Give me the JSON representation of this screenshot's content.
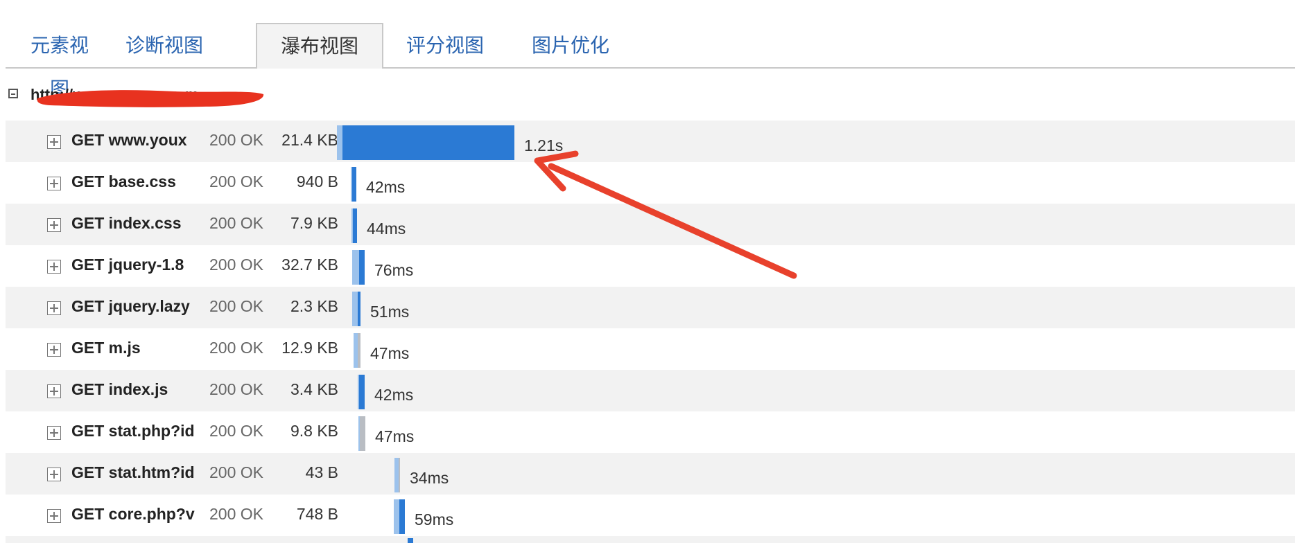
{
  "tabs": [
    {
      "label": "元素视图"
    },
    {
      "label": "诊断视图"
    },
    {
      "label": "瀑布视图"
    },
    {
      "label": "评分视图"
    },
    {
      "label": "图片优化"
    }
  ],
  "active_tab": "瀑布视图",
  "root": {
    "url": "http://www.yo.............m"
  },
  "requests": [
    {
      "name": "GET www.youx",
      "status": "200 OK",
      "size": "21.4 KB",
      "time": "1.21s"
    },
    {
      "name": "GET base.css",
      "status": "200 OK",
      "size": "940 B",
      "time": "42ms"
    },
    {
      "name": "GET index.css",
      "status": "200 OK",
      "size": "7.9 KB",
      "time": "44ms"
    },
    {
      "name": "GET jquery-1.8",
      "status": "200 OK",
      "size": "32.7 KB",
      "time": "76ms"
    },
    {
      "name": "GET jquery.lazy",
      "status": "200 OK",
      "size": "2.3 KB",
      "time": "51ms"
    },
    {
      "name": "GET m.js",
      "status": "200 OK",
      "size": "12.9 KB",
      "time": "47ms"
    },
    {
      "name": "GET index.js",
      "status": "200 OK",
      "size": "3.4 KB",
      "time": "42ms"
    },
    {
      "name": "GET stat.php?id",
      "status": "200 OK",
      "size": "9.8 KB",
      "time": "47ms"
    },
    {
      "name": "GET stat.htm?id",
      "status": "200 OK",
      "size": "43 B",
      "time": "34ms"
    },
    {
      "name": "GET core.php?v",
      "status": "200 OK",
      "size": "748 B",
      "time": "59ms"
    }
  ],
  "colors": {
    "bar_dark": "#2b7ad4",
    "bar_light": "#9cc2ec",
    "arrow": "#e8412c"
  },
  "icons": {
    "collapse": "minus-box-icon",
    "expand": "plus-box-icon"
  }
}
